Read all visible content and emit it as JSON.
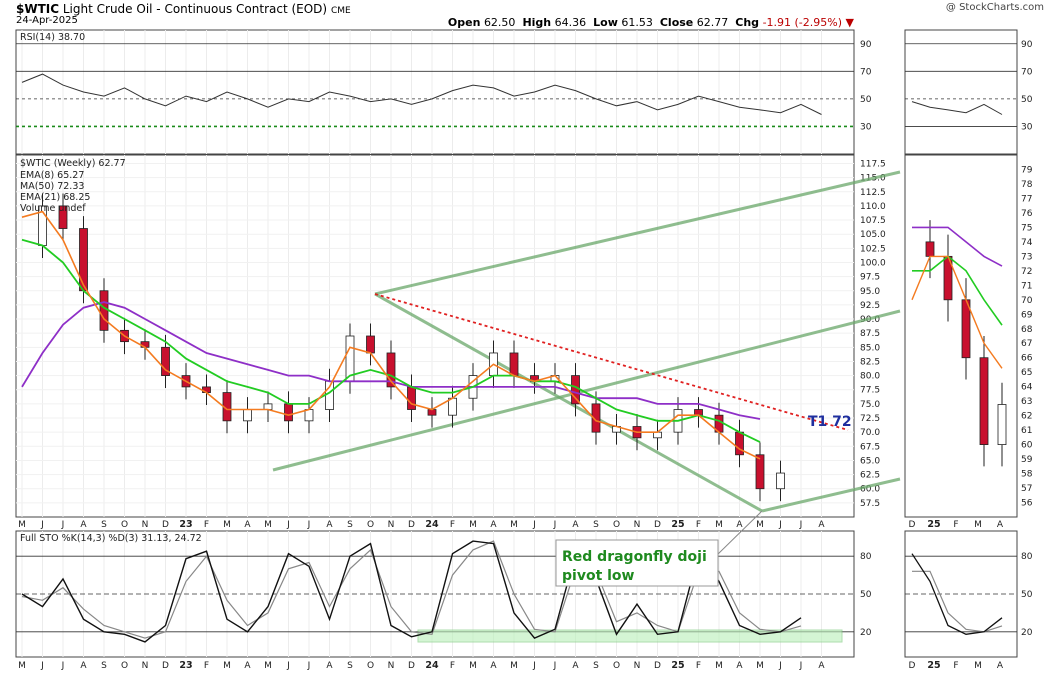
{
  "header": {
    "symbol": "$WTIC",
    "title": "Light Crude Oil - Continuous Contract (EOD)",
    "exchange": "CME",
    "date": "24-Apr-2025",
    "brand": "@ StockCharts.com",
    "open_label": "Open",
    "open": "62.50",
    "high_label": "High",
    "high": "64.36",
    "low_label": "Low",
    "low": "61.53",
    "close_label": "Close",
    "close": "62.77",
    "chg_label": "Chg",
    "chg": "-1.91 (-2.95%)"
  },
  "colors": {
    "up": "#ffffff",
    "down": "#c8102e",
    "ema8": "#f47b20",
    "ma50": "#8e2fc7",
    "ema21": "#22cc22",
    "trend": "#6aa86a",
    "resistance": "#e02020",
    "target": "#1f2f9f"
  },
  "rsi_panel": {
    "label": "RSI(14) 38.70",
    "levels": [
      90,
      70,
      50,
      30
    ]
  },
  "price_panel": {
    "label": "$WTIC (Weekly) 62.77",
    "legend": [
      {
        "text": "EMA(8) 65.27",
        "color": "#f47b20"
      },
      {
        "text": "MA(50) 72.33",
        "color": "#8e2fc7"
      },
      {
        "text": "EMA(21) 68.25",
        "color": "#22cc22"
      },
      {
        "text": "Volume undef",
        "color": "#333333"
      }
    ],
    "target_label": "T1 72"
  },
  "sto_panel": {
    "label": "Full STO %K(14,3) %D(3) 31.13, 24.72",
    "levels": [
      80,
      50,
      20
    ]
  },
  "annotation": {
    "line1": "Red dragonfly doji",
    "line2": "pivot low"
  },
  "month_labels": [
    "M",
    "J",
    "J",
    "A",
    "S",
    "O",
    "N",
    "D",
    "23",
    "F",
    "M",
    "A",
    "M",
    "J",
    "J",
    "A",
    "S",
    "O",
    "N",
    "D",
    "24",
    "F",
    "M",
    "A",
    "M",
    "J",
    "J",
    "A",
    "S",
    "O",
    "N",
    "D",
    "25",
    "F",
    "M",
    "A",
    "M",
    "J",
    "J",
    "A"
  ],
  "inset_month_labels": [
    "D",
    "25",
    "F",
    "M",
    "A"
  ],
  "chart_data": [
    {
      "type": "line",
      "title": "RSI(14) 38.70",
      "series": [
        {
          "name": "RSI(14)",
          "values": [
            62,
            68,
            60,
            55,
            52,
            58,
            50,
            45,
            52,
            48,
            55,
            50,
            44,
            50,
            48,
            55,
            52,
            48,
            50,
            46,
            50,
            56,
            60,
            58,
            52,
            55,
            60,
            56,
            50,
            45,
            48,
            42,
            46,
            52,
            48,
            44,
            42,
            40,
            46,
            38.7
          ]
        }
      ],
      "levels": [
        90,
        70,
        50,
        30
      ],
      "ylim": [
        10,
        100
      ]
    },
    {
      "type": "candlestick",
      "title": "$WTIC (Weekly) 62.77",
      "x": [
        "M",
        "J",
        "J",
        "A",
        "S",
        "O",
        "N",
        "D",
        "23",
        "F",
        "M",
        "A",
        "M",
        "J",
        "J",
        "A",
        "S",
        "O",
        "N",
        "D",
        "24",
        "F",
        "M",
        "A",
        "M",
        "J",
        "J",
        "A",
        "S",
        "O",
        "N",
        "D",
        "25",
        "F",
        "M",
        "A",
        "M",
        "J",
        "J",
        "A"
      ],
      "series": [
        {
          "name": "Close",
          "values": [
            103,
            110,
            106,
            95,
            88,
            86,
            85,
            80,
            78,
            77,
            72,
            74,
            75,
            72,
            74,
            79,
            87,
            84,
            78,
            74,
            73,
            76,
            80,
            84,
            80,
            79,
            80,
            75,
            70,
            71,
            69,
            70,
            74,
            73,
            70,
            66,
            60,
            62.77,
            null,
            null
          ]
        },
        {
          "name": "EMA(8) 65.27",
          "values": [
            108,
            109,
            104,
            96,
            90,
            87,
            85,
            81,
            79,
            77,
            74,
            74,
            74,
            73,
            74,
            78,
            85,
            84,
            79,
            75,
            74,
            76,
            79,
            82,
            80,
            79,
            80,
            76,
            72,
            71,
            70,
            70,
            73,
            73,
            70,
            67,
            65.27,
            null,
            null,
            null
          ]
        },
        {
          "name": "MA(50) 72.33",
          "values": [
            78,
            84,
            89,
            92,
            93,
            92,
            90,
            88,
            86,
            84,
            83,
            82,
            81,
            80,
            80,
            79,
            79,
            79,
            79,
            78,
            78,
            78,
            78,
            78,
            78,
            78,
            78,
            77,
            76,
            76,
            76,
            75,
            75,
            75,
            74,
            73,
            72.33,
            null,
            null,
            null
          ]
        },
        {
          "name": "EMA(21) 68.25",
          "values": [
            104,
            103,
            100,
            95,
            92,
            90,
            88,
            86,
            83,
            81,
            79,
            78,
            77,
            75,
            75,
            77,
            80,
            81,
            80,
            78,
            77,
            77,
            78,
            80,
            80,
            79,
            79,
            78,
            76,
            74,
            73,
            72,
            72,
            73,
            72,
            70,
            68.25,
            null,
            null,
            null
          ]
        }
      ],
      "annotations": [
        "T1 72",
        "Red dragonfly doji pivot low"
      ],
      "ylim": [
        55,
        119
      ]
    },
    {
      "type": "line",
      "title": "Full STO %K(14,3) %D(3) 31.13, 24.72",
      "series": [
        {
          "name": "%K(14,3)",
          "values": [
            50,
            40,
            62,
            30,
            20,
            18,
            12,
            25,
            78,
            84,
            30,
            20,
            40,
            82,
            72,
            30,
            80,
            90,
            25,
            16,
            20,
            82,
            92,
            90,
            35,
            15,
            22,
            82,
            62,
            18,
            42,
            18,
            20,
            82,
            60,
            25,
            18,
            20,
            31.13,
            null
          ]
        },
        {
          "name": "%D(3)",
          "values": [
            48,
            45,
            55,
            38,
            25,
            20,
            15,
            20,
            60,
            80,
            45,
            25,
            35,
            70,
            75,
            40,
            70,
            85,
            40,
            20,
            18,
            65,
            85,
            92,
            50,
            22,
            20,
            70,
            68,
            28,
            35,
            25,
            20,
            68,
            68,
            35,
            22,
            20,
            24.72,
            null
          ]
        }
      ],
      "levels": [
        80,
        50,
        20
      ],
      "ylim": [
        0,
        100
      ]
    }
  ]
}
